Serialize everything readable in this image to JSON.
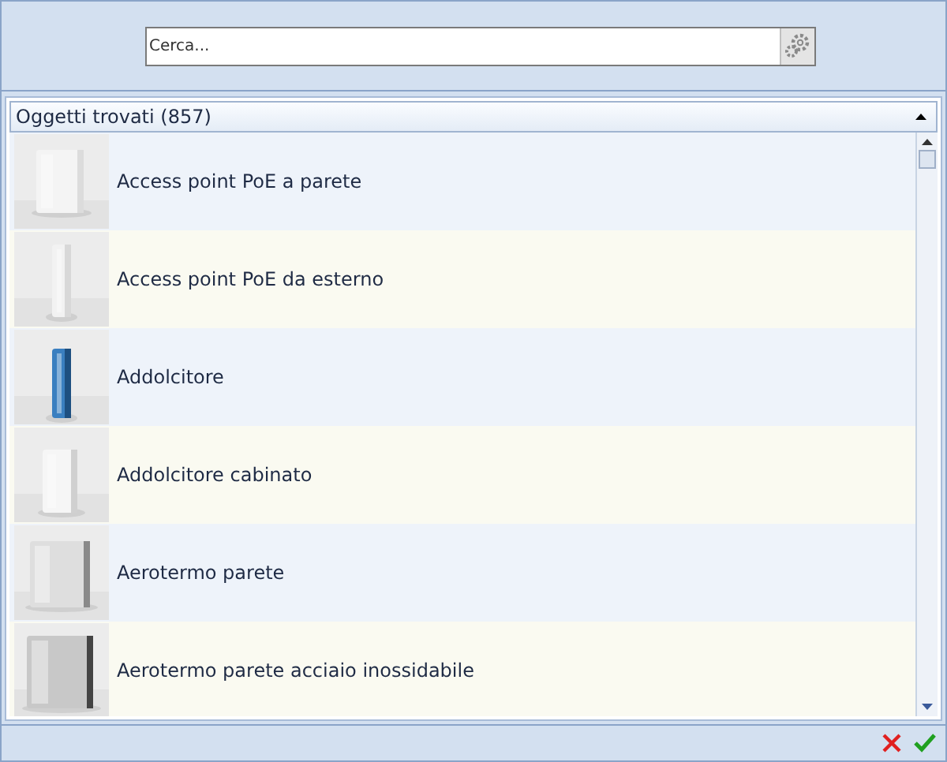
{
  "search": {
    "placeholder": "Cerca..."
  },
  "list": {
    "title": "Oggetti trovati (857)",
    "expanded": true,
    "items": [
      {
        "label": "Access point PoE a parete"
      },
      {
        "label": "Access point PoE da esterno"
      },
      {
        "label": "Addolcitore"
      },
      {
        "label": "Addolcitore cabinato"
      },
      {
        "label": "Aerotermo parete"
      },
      {
        "label": "Aerotermo parete acciaio inossidabile"
      }
    ]
  }
}
